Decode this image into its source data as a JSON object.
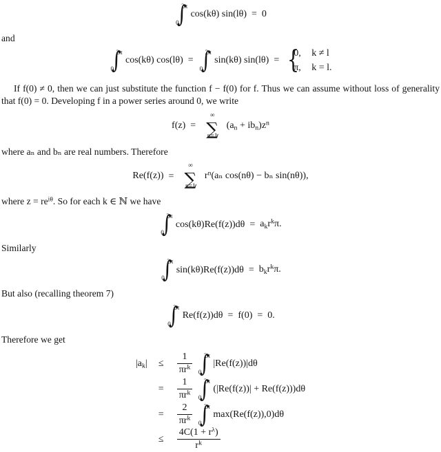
{
  "document": {
    "type": "mathematical-proof-page",
    "background_color": "#ffffff",
    "text_color": "#141414"
  },
  "blocks": {
    "eq_ortho_cos_sin": {
      "integral_lower": "0",
      "integral_upper": "2π",
      "integrand": "cos(kθ) sin(lθ)",
      "relation": "=",
      "result": "0"
    },
    "word_and": "and",
    "eq_ortho_cases": {
      "int1_lower": "0",
      "int1_upper": "2π",
      "int1_integrand": "cos(kθ) cos(lθ)",
      "eq1": "=",
      "int2_lower": "0",
      "int2_upper": "2π",
      "int2_integrand": "sin(kθ) sin(lθ)",
      "eq2": "=",
      "case1_value": "0,",
      "case1_cond": "k ≠ l",
      "case2_value": "π,",
      "case2_cond": "k = l."
    },
    "para_substitute": {
      "part1": "If f(0) ≠ 0, then we can just substitute the function f − f(0) for f. Thus we can assume without loss of generality that f(0) = 0. Developing f in a power series around 0, we write"
    },
    "eq_power_series": {
      "lhs": "f(z)",
      "relation": "=",
      "sum_lower": "n=1",
      "sum_upper": "∞",
      "term_open": "(a",
      "term_sub1": "n",
      "term_plus": "+ ib",
      "term_sub2": "n",
      "term_close": ")z",
      "term_exp": "n"
    },
    "para_real_coeffs": "where aₙ and bₙ are real numbers. Therefore",
    "eq_real_part": {
      "lhs": "Re(f(z))",
      "relation": "=",
      "sum_lower": "n=1",
      "sum_upper": "∞",
      "base": "r",
      "exponent": "n",
      "body": "(aₙ cos(nθ) − bₙ sin(nθ)),"
    },
    "para_polar": "where z = re^{iθ}. So for each k ∈ ℕ we have",
    "para_polar_pre": "where z = re",
    "para_polar_sup": "iθ",
    "para_polar_post": ". So for each k ∈ ℕ we have",
    "eq_cos_integral": {
      "integral_lower": "0",
      "integral_upper": "2π",
      "integrand": "cos(kθ)Re(f(z))dθ",
      "relation": "=",
      "rhs_a": "a",
      "rhs_a_sub": "k",
      "rhs_r": "r",
      "rhs_r_sup": "k",
      "rhs_pi": "π."
    },
    "word_similarly": "Similarly",
    "eq_sin_integral": {
      "integral_lower": "0",
      "integral_upper": "2π",
      "integrand": "sin(kθ)Re(f(z))dθ",
      "relation": "=",
      "rhs_b": "b",
      "rhs_b_sub": "k",
      "rhs_r": "r",
      "rhs_r_sup": "k",
      "rhs_pi": "π."
    },
    "word_but_also": "But also (recalling theorem 7)",
    "eq_mean_value": {
      "integral_lower": "0",
      "integral_upper": "2π",
      "integrand": "Re(f(z))dθ",
      "relation1": "=",
      "middle": "f(0)",
      "relation2": "=",
      "result": "0."
    },
    "word_therefore": "Therefore we get",
    "derivation": {
      "lhs_label": "|a",
      "lhs_label_sub": "k",
      "lhs_label_end": "|",
      "rows": [
        {
          "relation": "≤",
          "frac_num": "1",
          "frac_den_base": "πr",
          "frac_den_sup": "k",
          "integral_lower": "0",
          "integral_upper": "2π",
          "integrand": "|Re(f(z))|dθ"
        },
        {
          "relation": "=",
          "frac_num": "1",
          "frac_den_base": "πr",
          "frac_den_sup": "k",
          "integral_lower": "0",
          "integral_upper": "2π",
          "integrand": "(|Re(f(z))| + Re(f(z)))dθ"
        },
        {
          "relation": "=",
          "frac_num": "2",
          "frac_den_base": "πr",
          "frac_den_sup": "k",
          "integral_lower": "0",
          "integral_upper": "2π",
          "integrand": "max(Re(f(z)),0)dθ"
        }
      ],
      "final_row": {
        "relation": "≤",
        "num_pre": "4C(1 + r",
        "num_sup": "λ",
        "num_post": ")",
        "den_base": "r",
        "den_sup": "k"
      }
    }
  }
}
